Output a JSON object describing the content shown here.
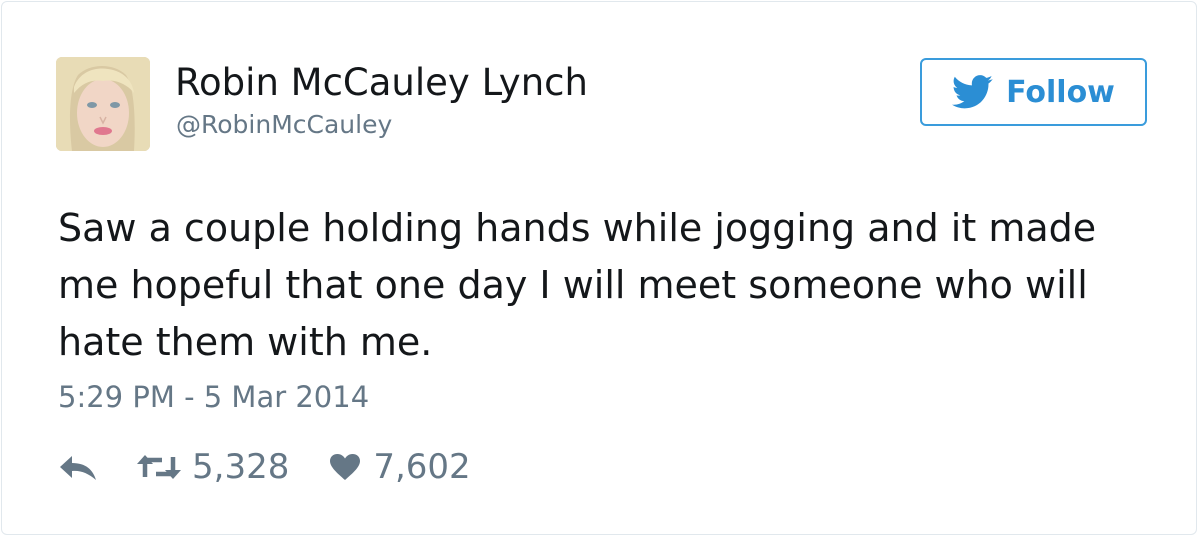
{
  "author": {
    "name": "Robin McCauley Lynch",
    "handle": "@RobinMcCauley"
  },
  "follow_button": {
    "label": "Follow",
    "icon": "twitter-bird-icon"
  },
  "tweet": {
    "text": "Saw a couple holding hands while jogging and it made me hopeful that one day I will meet someone who will hate them with me.",
    "timestamp": "5:29 PM - 5 Mar 2014"
  },
  "stats": {
    "retweets": "5,328",
    "likes": "7,602"
  },
  "icons": {
    "reply": "reply-icon",
    "retweet": "retweet-icon",
    "like": "heart-icon"
  },
  "colors": {
    "accent": "#1da1f2",
    "muted": "#657786",
    "text": "#14171a",
    "border": "#e1e8ed"
  }
}
